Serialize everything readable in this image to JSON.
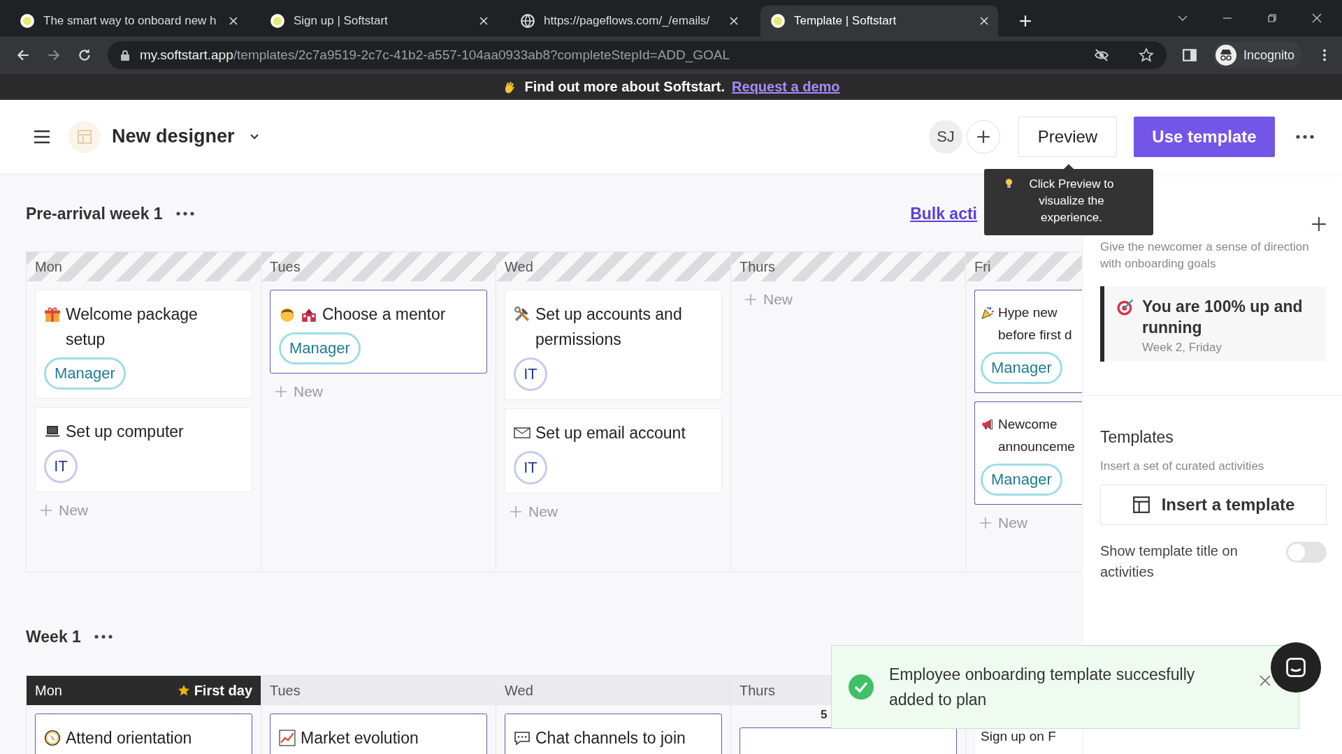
{
  "browser": {
    "tabs": [
      {
        "title": "The smart way to onboard new h",
        "selected": false,
        "kind": "site"
      },
      {
        "title": "Sign up | Softstart",
        "selected": false,
        "kind": "site"
      },
      {
        "title": "https://pageflows.com/_/emails/",
        "selected": false,
        "kind": "globe"
      },
      {
        "title": "Template | Softstart",
        "selected": true,
        "kind": "site"
      }
    ],
    "url_host": "my.softstart.app",
    "url_path": "/templates/2c7a9519-2c7c-41b2-a557-104aa0933ab8?completeStepId=ADD_GOAL",
    "profile": "Incognito"
  },
  "banner": {
    "text": "Find out more about Softstart.",
    "link": "Request a demo"
  },
  "header": {
    "title": "New designer",
    "avatar": "SJ",
    "preview": "Preview",
    "primary": "Use template"
  },
  "tooltip": {
    "text": "Click Preview to visualize the experience."
  },
  "sections": [
    {
      "title": "Pre-arrival week 1",
      "striped": true,
      "bulk_action": "Bulk acti",
      "days": [
        {
          "name": "Mon",
          "add_label": "New",
          "cards": [
            {
              "title": "Welcome package setup",
              "kind": "gift",
              "highlighted": false,
              "tag": {
                "label": "Manager",
                "kind": "pill",
                "color": "#9edcea"
              }
            },
            {
              "title": "Set up computer",
              "kind": "laptop",
              "highlighted": false,
              "tag": {
                "label": "IT",
                "kind": "circle",
                "color": "#c9c9f0"
              }
            }
          ]
        },
        {
          "name": "Tues",
          "add_label": "New",
          "cards": [
            {
              "title": "Choose a mentor",
              "kind": "mentor",
              "highlighted": true,
              "tag": {
                "label": "Manager",
                "kind": "pill",
                "color": "#9edcea"
              }
            }
          ]
        },
        {
          "name": "Wed",
          "add_label": "New",
          "cards": [
            {
              "title": "Set up accounts and permissions",
              "kind": "tools",
              "highlighted": false,
              "tag": {
                "label": "IT",
                "kind": "circle",
                "color": "#c9c9f0"
              }
            },
            {
              "title": "Set up email account",
              "kind": "envelope",
              "highlighted": false,
              "tag": {
                "label": "IT",
                "kind": "circle",
                "color": "#c9c9f0"
              }
            }
          ]
        },
        {
          "name": "Thurs",
          "add_label": "New"
        },
        {
          "name": "Fri",
          "add_label": "New",
          "cards": [
            {
              "title": "Hype new before first d",
              "kind": "party",
              "highlighted": true,
              "tag": {
                "label": "Manager",
                "kind": "pill",
                "color": "#9edcea"
              }
            },
            {
              "title": "Newcome announceme",
              "kind": "megaphone",
              "highlighted": true,
              "tag": {
                "label": "Manager",
                "kind": "pill",
                "color": "#9edcea"
              }
            }
          ]
        }
      ]
    },
    {
      "title": "Week 1",
      "striped": false,
      "days": [
        {
          "name": "Mon",
          "first_day": "First day",
          "cards": [
            {
              "title": "Attend orientation",
              "kind": "compass",
              "highlighted": true
            }
          ]
        },
        {
          "name": "Tues",
          "cards": [
            {
              "title": "Market evolution",
              "kind": "chart",
              "highlighted": true
            }
          ]
        },
        {
          "name": "Wed",
          "cards": [
            {
              "title": "Chat channels to join",
              "kind": "speech",
              "highlighted": true
            }
          ]
        },
        {
          "name": "Thurs",
          "count": "5",
          "cards": [
            {
              "kind": "blank",
              "highlighted": true
            }
          ]
        },
        {
          "cards": [
            {
              "title": "Sign up on F",
              "kind": "plain",
              "highlighted": false
            }
          ]
        }
      ]
    }
  ],
  "right_panel": {
    "goals_hint": "Give the newcomer a sense of direction with onboarding goals",
    "goal": {
      "title": "You are 100% up and running",
      "when": "Week 2, Friday"
    },
    "templates_title": "Templates",
    "templates_hint": "Insert a set of curated activities",
    "insert": "Insert a template",
    "toggle": {
      "label": "Show template title on activities",
      "on": false
    }
  },
  "toast": {
    "text": "Employee onboarding template succesfully added to plan"
  }
}
